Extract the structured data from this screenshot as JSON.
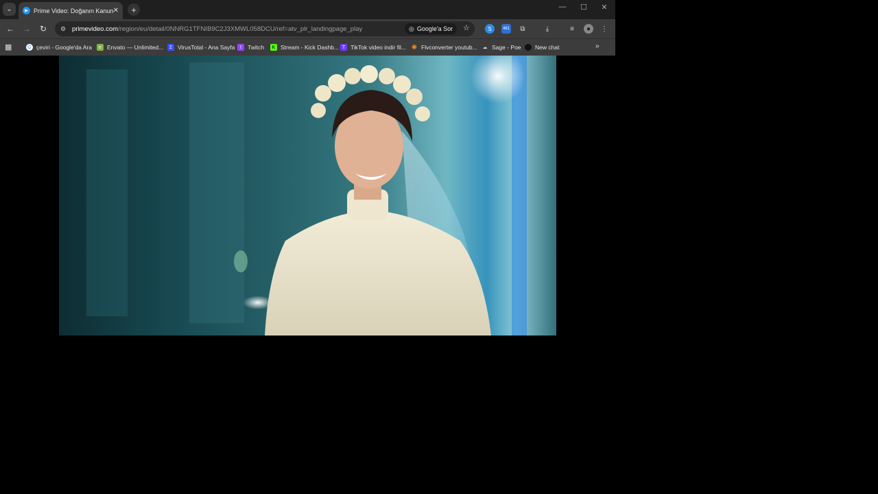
{
  "tab": {
    "title": "Prime Video: Doğanın Kanunu",
    "close_glyph": "✕"
  },
  "toolbar": {
    "url_host": "primevideo.com",
    "url_path": "/region/eu/detail/0NNRG1TFNIB9C2J3XMWL058DCU/ref=atv_plr_landingpage_play",
    "google_ask_label": "Google'a Sor",
    "badge_count": "461"
  },
  "bookmarks": [
    {
      "label": "çeviri - Google'da Ara",
      "icon": "google-icon",
      "color": "#ffffff"
    },
    {
      "label": "Envato — Unlimited...",
      "icon": "envato-icon",
      "color": "#81b441"
    },
    {
      "label": "VirusTotal - Ana Sayfa",
      "icon": "virustotal-icon",
      "color": "#394eff"
    },
    {
      "label": "Twitch",
      "icon": "twitch-icon",
      "color": "#9146ff"
    },
    {
      "label": "Stream - Kick Dashb...",
      "icon": "kick-icon",
      "color": "#53fc18"
    },
    {
      "label": "TikTok video indir fil...",
      "icon": "tiktok-icon",
      "color": "#6b3cff"
    },
    {
      "label": "Flvconverter youtub...",
      "icon": "flvconverter-icon",
      "color": "#f08a24"
    },
    {
      "label": "Sage - Poe",
      "icon": "poe-icon",
      "color": "#cfcfcf"
    },
    {
      "label": "New chat",
      "icon": "chat-icon",
      "color": "#111111"
    }
  ],
  "colors": {
    "tabstrip": "#1f1f1f",
    "toolbar": "#3c3c3c",
    "omnibox": "#282828",
    "page_background": "#000000"
  }
}
